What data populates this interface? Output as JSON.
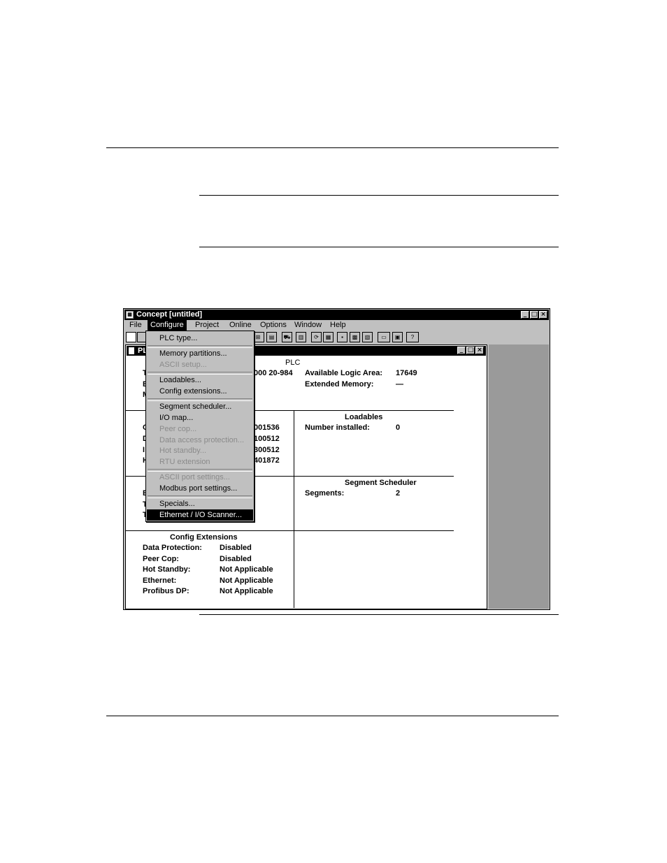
{
  "window": {
    "title": "Concept [untitled]",
    "controls": {
      "minimize": "_",
      "maximize": "□",
      "close": "×"
    }
  },
  "menubar": [
    "File",
    "Configure",
    "Project",
    "Online",
    "Options",
    "Window",
    "Help"
  ],
  "configure_menu": [
    {
      "label": "PLC type...",
      "enabled": true
    },
    {
      "label": "Memory partitions...",
      "enabled": true
    },
    {
      "label": "ASCII setup...",
      "enabled": false
    },
    {
      "label": "Loadables...",
      "enabled": true
    },
    {
      "label": "Config extensions...",
      "enabled": true
    },
    {
      "label": "Segment scheduler...",
      "enabled": true
    },
    {
      "label": "I/O map...",
      "enabled": true
    },
    {
      "label": "Peer cop...",
      "enabled": false
    },
    {
      "label": "Data access protection...",
      "enabled": false
    },
    {
      "label": "Hot standby...",
      "enabled": false
    },
    {
      "label": "RTU extension",
      "enabled": false
    },
    {
      "label": "ASCII port settings...",
      "enabled": false
    },
    {
      "label": "Modbus port settings...",
      "enabled": true
    },
    {
      "label": "Specials...",
      "enabled": true
    },
    {
      "label": "Ethernet / I/O Scanner...",
      "enabled": true,
      "highlighted": true
    }
  ],
  "child": {
    "title": "PL",
    "plc": {
      "heading": "PLC",
      "left_partial": [
        "T",
        "E",
        "M"
      ],
      "type_fragment": "000 20-984",
      "available_logic_label": "Available Logic Area:",
      "available_logic_value": "17649",
      "extended_memory_label": "Extended Memory:",
      "extended_memory_value": "—"
    },
    "memory": {
      "left_partial": [
        "C",
        "D",
        "I",
        "H"
      ],
      "values": [
        "001536",
        "100512",
        "300512",
        "401872"
      ]
    },
    "loadables": {
      "heading": "Loadables",
      "number_label": "Number installed:",
      "number_value": "0"
    },
    "segment": {
      "left_partial": [
        "E",
        "T",
        "T"
      ],
      "heading": "Segment Scheduler",
      "segments_label": "Segments:",
      "segments_value": "2"
    },
    "config_ext": {
      "heading": "Config Extensions",
      "rows": [
        {
          "label": "Data Protection:",
          "value": "Disabled"
        },
        {
          "label": "Peer Cop:",
          "value": "Disabled"
        },
        {
          "label": "Hot Standby:",
          "value": "Not Applicable"
        },
        {
          "label": "Ethernet:",
          "value": "Not Applicable"
        },
        {
          "label": "Profibus DP:",
          "value": "Not Applicable"
        }
      ]
    }
  }
}
